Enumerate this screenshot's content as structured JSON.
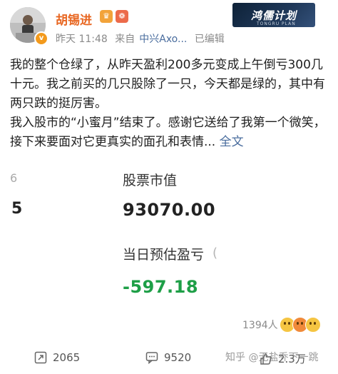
{
  "header": {
    "author_name": "胡锡进",
    "time": "昨天 11:48",
    "source_prefix": "来自",
    "source_device": "中兴Axo...",
    "edited": "已编辑",
    "verified_mark": "v"
  },
  "brand_tag": {
    "title": "鸿儒计划",
    "subtitle": "TONGRU PLAN"
  },
  "post": {
    "paragraph_1": "我的整个仓绿了，从昨天盈利200多元变成上午倒亏300几十元。我之前买的几只股除了一只，今天都是绿的，其中有两只跌的挺厉害。",
    "paragraph_2": "我入股市的“小蜜月”结束了。感谢它送给了我第一个微笑，接下来要面对它更真实的面孔和表情... ",
    "full_text_link": "全文"
  },
  "embedded_screenshot": {
    "left_partial_value": "5",
    "market_value_label": "股票市值",
    "market_value": "93070.00",
    "daily_pl_label": "当日预估盈亏",
    "daily_pl_value": "-597.18",
    "colors": {
      "loss": "#1e9f47"
    }
  },
  "reactions": {
    "count": "1394人",
    "emojis": [
      "surprised-emoji",
      "laughing-emoji",
      "grinning-emoji"
    ]
  },
  "actions": {
    "repost_count": "2065",
    "comment_count": "9520",
    "like_count": "2.3万"
  },
  "watermark": "知乎 @无盐乔下一跳",
  "colors": {
    "author_name": "#e86722",
    "link": "#4a6d9e",
    "meta": "#8a8a8a"
  }
}
